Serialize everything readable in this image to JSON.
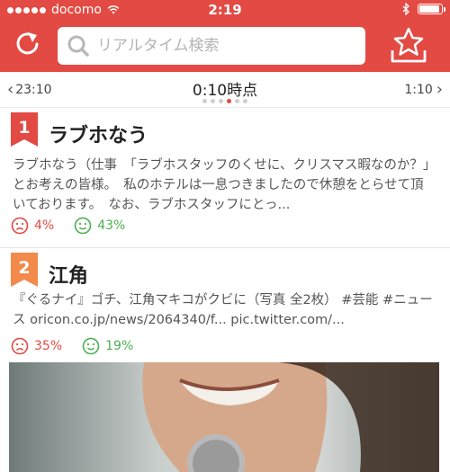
{
  "statusbar": {
    "carrier": "docomo",
    "time": "2:19"
  },
  "search": {
    "placeholder": "リアルタイム検索"
  },
  "timenav": {
    "prev": "23:10",
    "current": "0:10時点",
    "next": "1:10",
    "active_page": 4,
    "page_count": 6
  },
  "items": [
    {
      "rank": "1",
      "rank_color": "#e24a43",
      "title": "ラブホなう",
      "body": "ラブホなう（仕事　「ラブホスタッフのくせに、クリスマス暇なのか？」とお考えの皆様。　私のホテルは一息つきましたので休憩をとらせて頂いております。　なお、ラブホスタッフにとっ...",
      "negative": "4%",
      "positive": "43%"
    },
    {
      "rank": "2",
      "rank_color": "#f28a4b",
      "title": "江角",
      "body": "『ぐるナイ』ゴチ、江角マキコがクビに（写真 全2枚） #芸能 #ニュース oricon.co.jp/news/2064340/f... pic.twitter.com/...",
      "negative": "35%",
      "positive": "19%"
    }
  ],
  "colors": {
    "accent": "#e24a43",
    "positive": "#4caf50",
    "rank2": "#f28a4b"
  }
}
